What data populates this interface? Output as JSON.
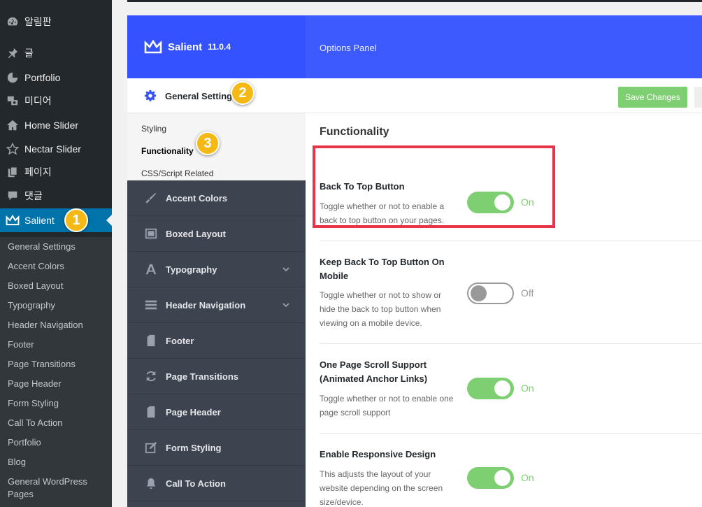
{
  "wp_menu": {
    "items": [
      {
        "label": "알림판",
        "icon": "dashboard-icon"
      },
      {
        "label": "글",
        "icon": "pin-icon"
      },
      {
        "label": "Portfolio",
        "icon": "portfolio-icon"
      },
      {
        "label": "미디어",
        "icon": "media-icon"
      },
      {
        "label": "Home Slider",
        "icon": "home-icon"
      },
      {
        "label": "Nectar Slider",
        "icon": "star-icon"
      },
      {
        "label": "페이지",
        "icon": "pages-icon"
      },
      {
        "label": "댓글",
        "icon": "comment-icon"
      },
      {
        "label": "Salient",
        "icon": "crown-icon",
        "active": true
      }
    ],
    "submenu": [
      "General Settings",
      "Accent Colors",
      "Boxed Layout",
      "Typography",
      "Header Navigation",
      "Footer",
      "Page Transitions",
      "Page Header",
      "Form Styling",
      "Call To Action",
      "Portfolio",
      "Blog",
      "General WordPress Pages"
    ]
  },
  "brand": {
    "name": "Salient",
    "version": "11.0.4"
  },
  "header": {
    "title": "Options Panel"
  },
  "toolbar": {
    "section_label": "General Settings",
    "save_label": "Save Changes"
  },
  "subnav": [
    "Styling",
    "Functionality",
    "CSS/Script Related"
  ],
  "sections": [
    {
      "label": "Accent Colors",
      "icon": "brush-icon"
    },
    {
      "label": "Boxed Layout",
      "icon": "boxed-layout-icon"
    },
    {
      "label": "Typography",
      "icon": "typography-icon",
      "expandable": true
    },
    {
      "label": "Header Navigation",
      "icon": "menu-icon",
      "expandable": true
    },
    {
      "label": "Footer",
      "icon": "page-icon"
    },
    {
      "label": "Page Transitions",
      "icon": "refresh-icon"
    },
    {
      "label": "Page Header",
      "icon": "page-icon"
    },
    {
      "label": "Form Styling",
      "icon": "edit-icon"
    },
    {
      "label": "Call To Action",
      "icon": "bell-icon"
    }
  ],
  "main": {
    "title": "Functionality",
    "options": [
      {
        "title": "Back To Top Button",
        "desc": "Toggle whether or not to enable a back to top button on your pages.",
        "state": "On"
      },
      {
        "title": "Keep Back To Top Button On Mobile",
        "desc": "Toggle whether or not to show or hide the back to top button when viewing on a mobile device.",
        "state": "Off"
      },
      {
        "title": "One Page Scroll Support (Animated Anchor Links)",
        "desc": "Toggle whether or not to enable one page scroll support",
        "state": "On"
      },
      {
        "title": "Enable Responsive Design",
        "desc": "This adjusts the layout of your website depending on the screen size/device.",
        "state": "On"
      }
    ]
  },
  "callouts": [
    "1",
    "2",
    "3"
  ],
  "colors": {
    "accent_blue": "#3d5afe",
    "toggle_on": "#7ecf71",
    "highlight": "#e8344a",
    "callout": "#f5b916"
  }
}
